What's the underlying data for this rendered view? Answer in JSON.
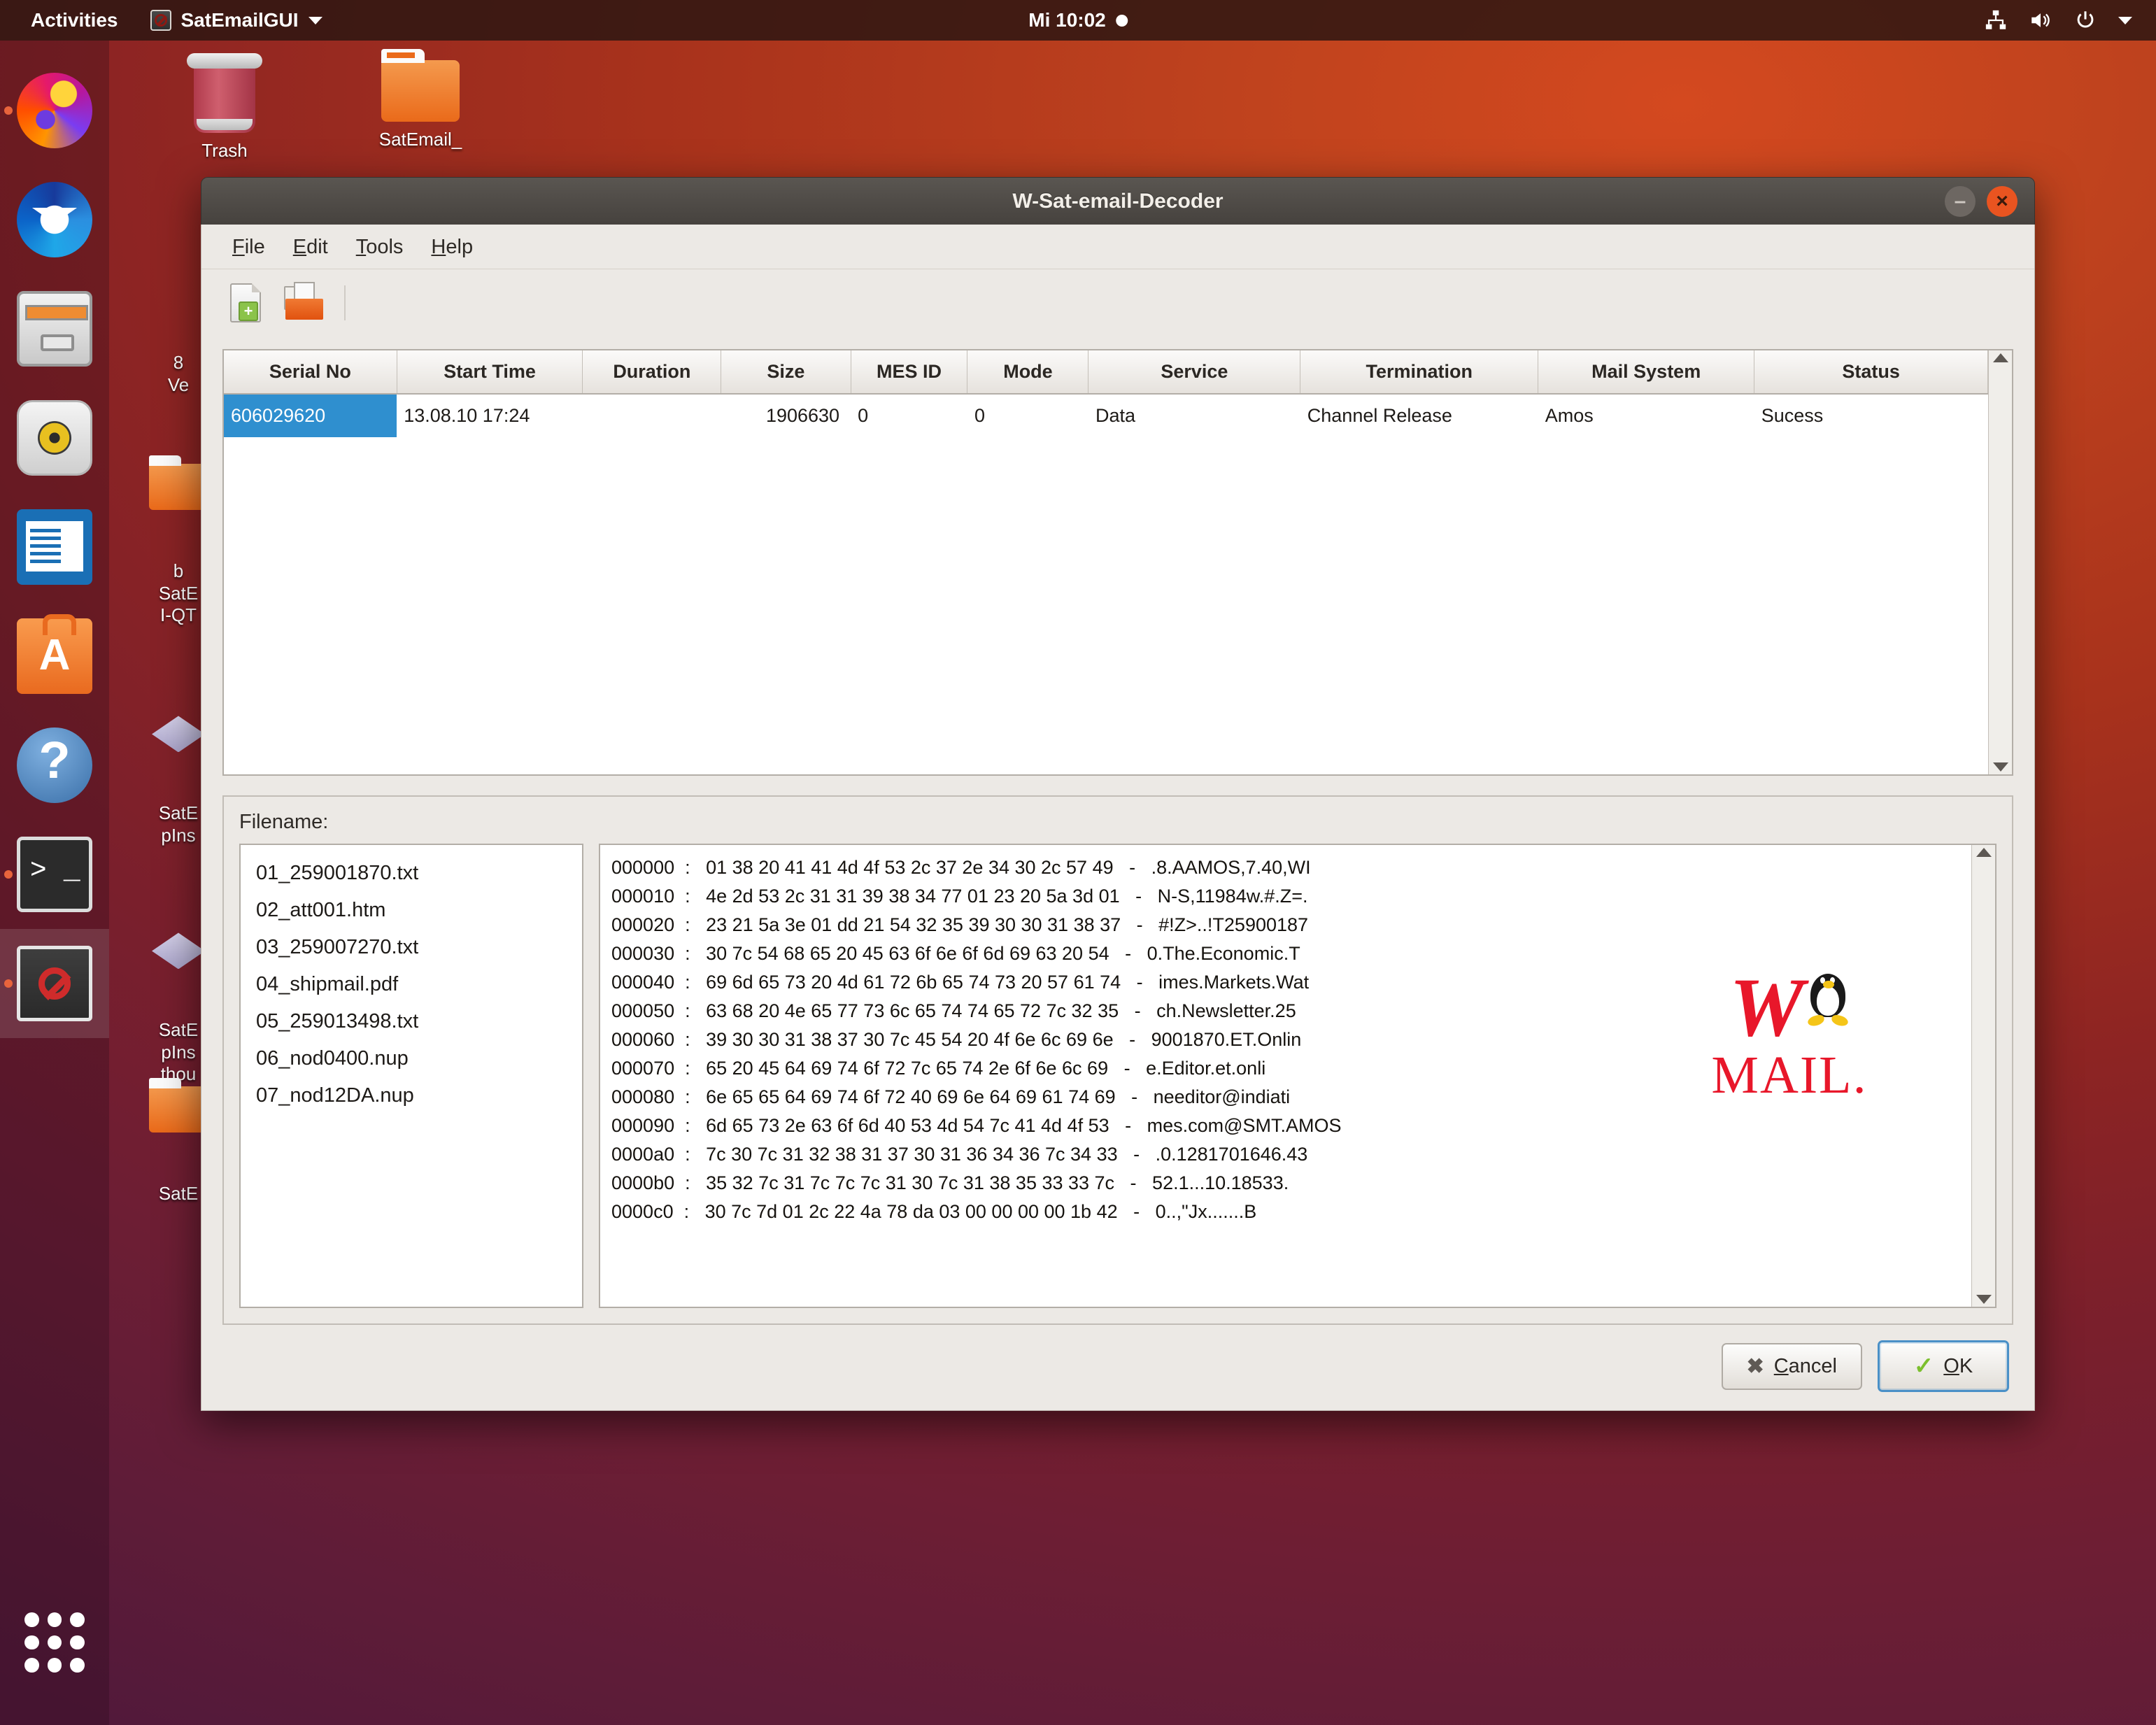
{
  "topbar": {
    "activities": "Activities",
    "app_name": "SatEmailGUI",
    "clock": "Mi 10:02",
    "tray": [
      "network-icon",
      "volume-icon",
      "power-icon",
      "chevron-down-icon"
    ]
  },
  "dock": {
    "items": [
      {
        "name": "firefox",
        "label": "Firefox",
        "running": true
      },
      {
        "name": "thunderbird",
        "label": "Thunderbird",
        "running": false
      },
      {
        "name": "files",
        "label": "Files",
        "running": false
      },
      {
        "name": "rhythmbox",
        "label": "Rhythmbox",
        "running": false
      },
      {
        "name": "libreoffice-writer",
        "label": "LibreOffice Writer",
        "running": false
      },
      {
        "name": "ubuntu-software",
        "label": "Ubuntu Software",
        "running": false
      },
      {
        "name": "help",
        "label": "Help",
        "running": false
      },
      {
        "name": "terminal",
        "label": "Terminal",
        "running": true
      },
      {
        "name": "satemailgui",
        "label": "SatEmailGUI",
        "running": true
      }
    ],
    "show_apps_label": "Show Applications"
  },
  "desktop": {
    "icons": [
      {
        "label": "Trash",
        "type": "trash"
      },
      {
        "label": "SatEmail_",
        "type": "folder"
      },
      {
        "label": "8\nVe",
        "type": "text"
      },
      {
        "label": "b\nSatE\nI-QT",
        "type": "folder-small"
      },
      {
        "label": "SatE\npIns",
        "type": "diamond"
      },
      {
        "label": "SatE\npIns\nthou",
        "type": "diamond"
      },
      {
        "label": "SatE",
        "type": "folder-small"
      }
    ]
  },
  "window": {
    "title": "W-Sat-email-Decoder",
    "controls": {
      "minimize": "–",
      "close": "×"
    },
    "menu": [
      {
        "mnemonic": "F",
        "rest": "ile"
      },
      {
        "mnemonic": "E",
        "rest": "dit"
      },
      {
        "mnemonic": "T",
        "rest": "ools"
      },
      {
        "mnemonic": "H",
        "rest": "elp"
      }
    ],
    "toolbar": [
      {
        "name": "new-file-icon",
        "tooltip": "New"
      },
      {
        "name": "open-folder-icon",
        "tooltip": "Open"
      }
    ]
  },
  "table": {
    "columns": [
      "Serial No",
      "Start Time",
      "Duration",
      "Size",
      "MES ID",
      "Mode",
      "Service",
      "Termination",
      "Mail System",
      "Status"
    ],
    "rows": [
      {
        "selected": true,
        "serial_no": "606029620",
        "start_time": "13.08.10 17:24",
        "duration": "",
        "size": "1906630",
        "mes_id": "0",
        "mode": "0",
        "service": "Data",
        "termination": "Channel Release",
        "mail_system": "Amos",
        "status": "Sucess"
      }
    ]
  },
  "filename_panel": {
    "label": "Filename:",
    "files": [
      "01_259001870.txt",
      "02_att001.htm",
      "03_259007270.txt",
      "04_shipmail.pdf",
      "05_259013498.txt",
      "06_nod0400.nup",
      "07_nod12DA.nup"
    ],
    "hex_lines": [
      "000000  :   01 38 20 41 41 4d 4f 53 2c 37 2e 34 30 2c 57 49   -   .8.AAMOS,7.40,WI",
      "000010  :   4e 2d 53 2c 31 31 39 38 34 77 01 23 20 5a 3d 01   -   N-S,11984w.#.Z=.",
      "000020  :   23 21 5a 3e 01 dd 21 54 32 35 39 30 30 31 38 37   -   #!Z>..!T25900187",
      "000030  :   30 7c 54 68 65 20 45 63 6f 6e 6f 6d 69 63 20 54   -   0.The.Economic.T",
      "000040  :   69 6d 65 73 20 4d 61 72 6b 65 74 73 20 57 61 74   -   imes.Markets.Wat",
      "000050  :   63 68 20 4e 65 77 73 6c 65 74 74 65 72 7c 32 35   -   ch.Newsletter.25",
      "000060  :   39 30 30 31 38 37 30 7c 45 54 20 4f 6e 6c 69 6e   -   9001870.ET.Onlin",
      "000070  :   65 20 45 64 69 74 6f 72 7c 65 74 2e 6f 6e 6c 69   -   e.Editor.et.onli",
      "000080  :   6e 65 65 64 69 74 6f 72 40 69 6e 64 69 61 74 69   -   needitor@indiati",
      "000090  :   6d 65 73 2e 63 6f 6d 40 53 4d 54 7c 41 4d 4f 53   -   mes.com@SMT.AMOS",
      "0000a0  :   7c 30 7c 31 32 38 31 37 30 31 36 34 36 7c 34 33   -   .0.1281701646.43",
      "0000b0  :   35 32 7c 31 7c 7c 7c 31 30 7c 31 38 35 33 33 7c   -   52.1...10.18533.",
      "0000c0  :   30 7c 7d 01 2c 22 4a 78 da 03 00 00 00 00 1b 42   -   0..,\"Jx.......B"
    ],
    "logo": {
      "w": "W",
      "mail": "MAIL.",
      "tux": "tux-penguin-icon"
    }
  },
  "footer": {
    "cancel": {
      "mnemonic": "C",
      "rest": "ancel"
    },
    "ok": {
      "mnemonic": "O",
      "rest": "K"
    }
  }
}
